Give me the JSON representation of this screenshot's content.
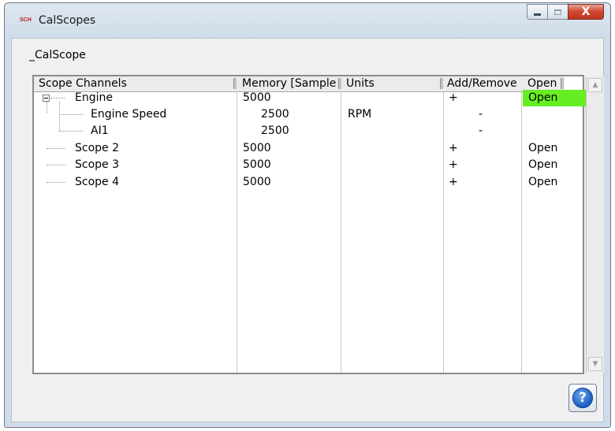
{
  "window": {
    "title": "CalScopes",
    "icon_text": "SCH",
    "close_label": "X"
  },
  "group": {
    "label": "_CalScope"
  },
  "tree": {
    "headers": {
      "channels": "Scope Channels",
      "memory": "Memory [Sample",
      "units": "Units",
      "add_remove": "Add/Remove",
      "open": "Open"
    },
    "rows": [
      {
        "name": "Engine",
        "memory": "5000",
        "units": "",
        "add_remove": "+",
        "open": "Open",
        "level": 0,
        "expanded": true,
        "open_highlight": "#66ee22"
      },
      {
        "name": "Engine Speed",
        "memory": "2500",
        "units": "RPM",
        "add_remove": "-",
        "open": "",
        "level": 1
      },
      {
        "name": "AI1",
        "memory": "2500",
        "units": "",
        "add_remove": "-",
        "open": "",
        "level": 1
      },
      {
        "name": "Scope 2",
        "memory": "5000",
        "units": "",
        "add_remove": "+",
        "open": "Open",
        "level": 0
      },
      {
        "name": "Scope 3",
        "memory": "5000",
        "units": "",
        "add_remove": "+",
        "open": "Open",
        "level": 0
      },
      {
        "name": "Scope 4",
        "memory": "5000",
        "units": "",
        "add_remove": "+",
        "open": "Open",
        "level": 0
      }
    ]
  },
  "help": {
    "glyph": "?"
  }
}
